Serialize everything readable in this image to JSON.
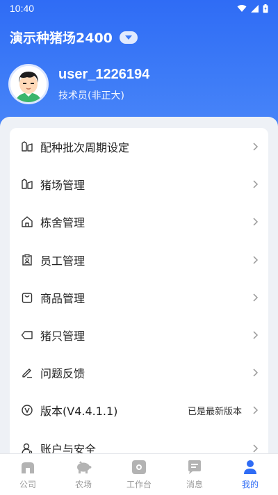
{
  "status_bar": {
    "time": "10:40"
  },
  "header": {
    "farm_name": "演示种猪场2400"
  },
  "profile": {
    "username": "user_1226194",
    "role": "技术员(非正大)"
  },
  "menu": [
    {
      "label": "配种批次周期设定",
      "icon": "columns-icon"
    },
    {
      "label": "猪场管理",
      "icon": "columns-icon"
    },
    {
      "label": "栋舍管理",
      "icon": "house-icon"
    },
    {
      "label": "员工管理",
      "icon": "clipboard-user-icon"
    },
    {
      "label": "商品管理",
      "icon": "bag-icon"
    },
    {
      "label": "猪只管理",
      "icon": "tag-icon"
    },
    {
      "label": "问题反馈",
      "icon": "pen-icon"
    },
    {
      "label": "版本(V4.4.1.1)",
      "icon": "version-icon",
      "extra": "已是最新版本"
    },
    {
      "label": "账户与安全",
      "icon": "user-icon"
    }
  ],
  "tabs": [
    {
      "label": "公司",
      "icon": "building-icon",
      "active": false
    },
    {
      "label": "农场",
      "icon": "pig-icon",
      "active": false
    },
    {
      "label": "工作台",
      "icon": "workbench-icon",
      "active": false
    },
    {
      "label": "消息",
      "icon": "message-icon",
      "active": false
    },
    {
      "label": "我的",
      "icon": "person-icon",
      "active": true
    }
  ],
  "colors": {
    "primary": "#2f6cf5",
    "inactive": "#999999"
  }
}
